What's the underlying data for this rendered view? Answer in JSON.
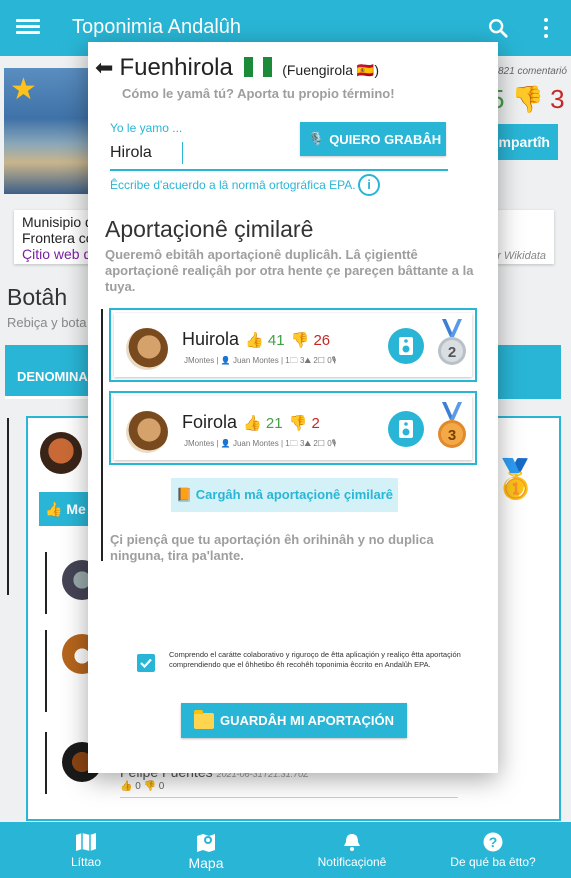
{
  "app": {
    "title": "Toponimia Andalûh"
  },
  "background": {
    "comment_count": "821 comentarió",
    "votes_up": "5",
    "votes_down": "3",
    "share_label": "ompartîh",
    "info": {
      "line1": "Munisipio d",
      "line2": "Frontera co",
      "line3": "Çitio web d",
      "source": "r Wikidata"
    },
    "section_title": "Botâh",
    "section_sub": "Rebiça y bota",
    "tab_label": "DENOMINA",
    "me_label": "Me",
    "comment": {
      "author": "Felipe Fuentes",
      "date": "2021-06-31T21:31:70Z",
      "votes": "0 👎 0"
    }
  },
  "dialog": {
    "place_name": "Fuenhirola",
    "place_original": "(Fuengirola 🇪🇸)",
    "subtitle": "Cómo le yamâ tú? Aporta tu propio término!",
    "input_label": "Yo le yamo ...",
    "input_value": "Hirola",
    "record_label": "QUIERO GRABÂH",
    "epa_hint": "Êccribe d'acuerdo a lâ normâ ortográfica EPA.",
    "info_symbol": "i",
    "similar_title": "Aportaçionê çimilarê",
    "similar_desc": "Queremô ebitâh aportaçionê duplicâh. Lâ çigienttê aportaçionê realiçâh por otra hente çe pareçen bâttante a la tuya.",
    "similar": [
      {
        "name": "Huirola",
        "up": "41",
        "down": "26",
        "author": "JMontes",
        "user": "Juan Montes",
        "stats": "1🗀  3⛰  2☐  0🎙",
        "rank": "2"
      },
      {
        "name": "Foirola",
        "up": "21",
        "down": "2",
        "author": "JMontes",
        "user": "Juan Montes",
        "stats": "1🗀  3⛰  2☐  0🎙",
        "rank": "3"
      }
    ],
    "load_more": "Cargâh mâ aportaçionê çimilarê",
    "original_note": "Çi piençâ que tu aportaçión êh orihinâh y no duplica ninguna, tira pa'lante.",
    "consent": "Comprendo el carátte colaborativo y riguroço de êtta aplicaçión y realiço êtta aportaçión comprendiendo que el ôhhetibo êh recohêh toponimia êccrito en Andalûh EPA.",
    "save_label": "GUARDÂH MI APORTAÇIÓN"
  },
  "bottom_nav": [
    {
      "label": "Líttao",
      "icon": "map-book-icon"
    },
    {
      "label": "Mapa",
      "icon": "map-pin-icon"
    },
    {
      "label": "Notificaçionê",
      "icon": "bell-icon"
    },
    {
      "label": "De qué ba êtto?",
      "icon": "help-icon"
    }
  ],
  "colors": {
    "primary": "#29b6d6",
    "vote_up": "#43a047",
    "vote_down": "#c62828",
    "muted": "#9e9e9e"
  }
}
